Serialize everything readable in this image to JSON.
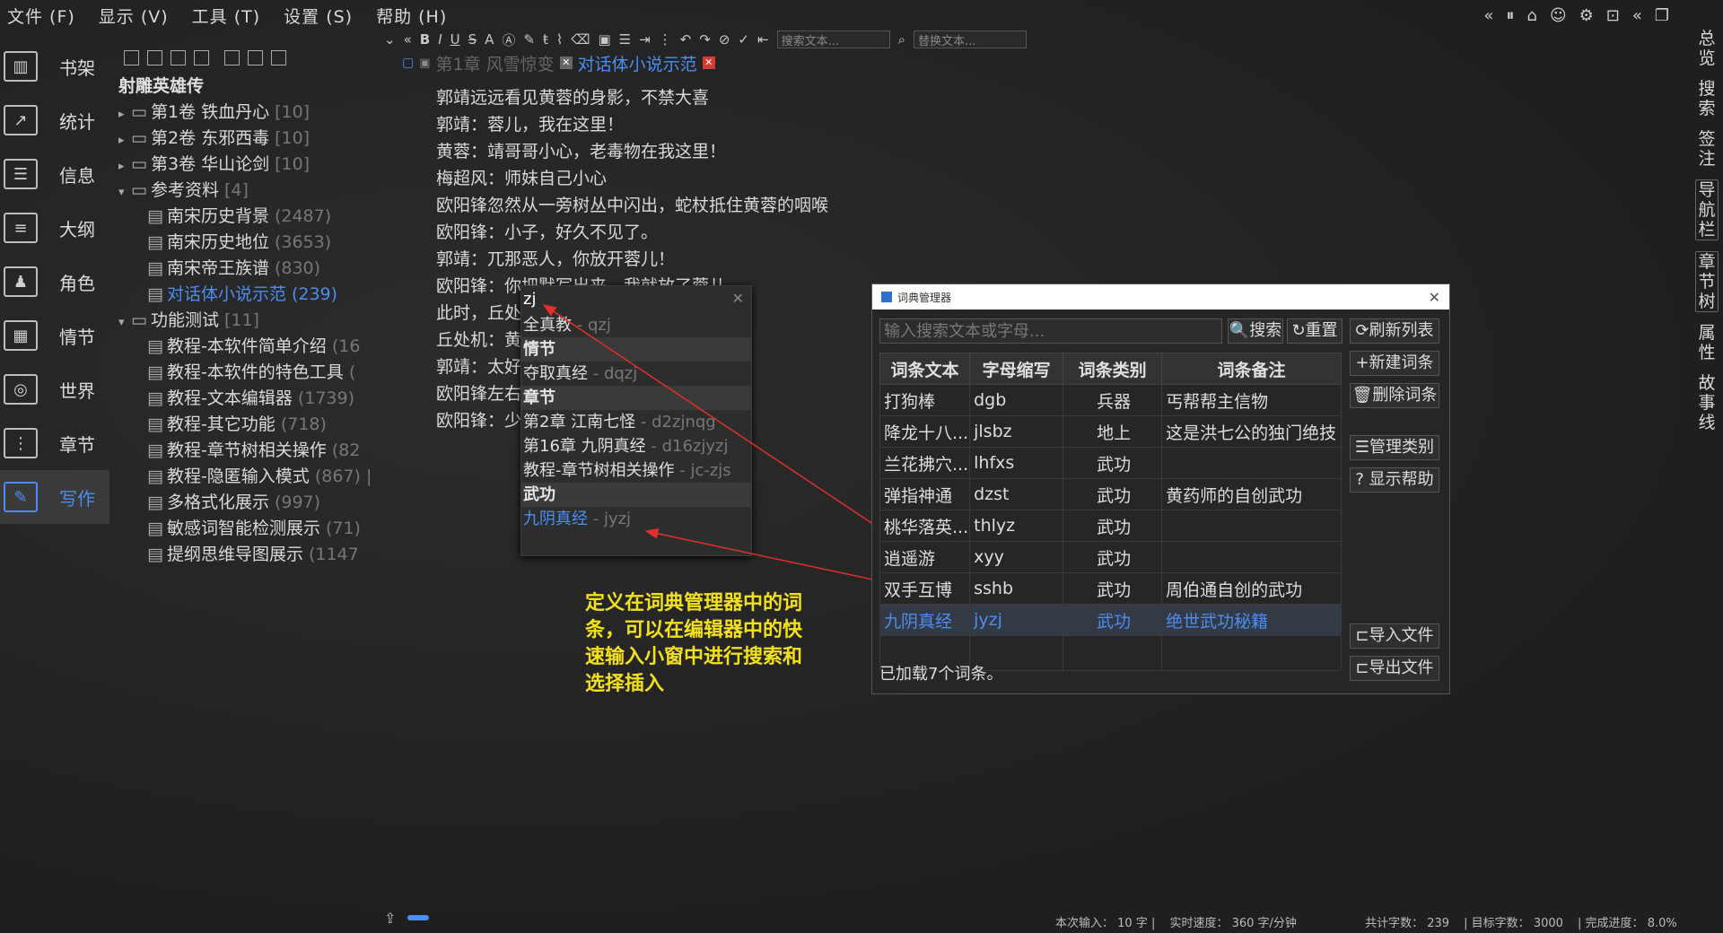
{
  "menu": [
    "文件 (F)",
    "显示 (V)",
    "工具 (T)",
    "设置 (S)",
    "帮助 (H)"
  ],
  "leftnav": [
    {
      "label": "书架",
      "icon": "bookshelf-icon",
      "glyph": "▥"
    },
    {
      "label": "统计",
      "icon": "stats-icon",
      "glyph": "↗"
    },
    {
      "label": "信息",
      "icon": "info-icon",
      "glyph": "☰"
    },
    {
      "label": "大纲",
      "icon": "outline-icon",
      "glyph": "≡"
    },
    {
      "label": "角色",
      "icon": "characters-icon",
      "glyph": "♟"
    },
    {
      "label": "情节",
      "icon": "plot-icon",
      "glyph": "▦"
    },
    {
      "label": "世界",
      "icon": "world-icon",
      "glyph": "◎"
    },
    {
      "label": "章节",
      "icon": "chapters-icon",
      "glyph": "⋮"
    },
    {
      "label": "写作",
      "icon": "write-icon",
      "glyph": "✎"
    }
  ],
  "tree": {
    "book": "射雕英雄传",
    "items": [
      {
        "label": "第1卷 铁血丹心",
        "count": "[10]"
      },
      {
        "label": "第2卷 东邪西毒",
        "count": "[10]"
      },
      {
        "label": "第3卷 华山论剑",
        "count": "[10]"
      },
      {
        "label": "参考资料",
        "count": "[4]"
      },
      {
        "label": "南宋历史背景",
        "count": "(2487)"
      },
      {
        "label": "南宋历史地位",
        "count": "(3653)"
      },
      {
        "label": "南宋帝王族谱",
        "count": "(830)"
      },
      {
        "label": "对话体小说示范",
        "count": "(239)"
      },
      {
        "label": "功能测试",
        "count": "[11]"
      },
      {
        "label": "教程-本软件简单介绍",
        "count": "(16"
      },
      {
        "label": "教程-本软件的特色工具",
        "count": "("
      },
      {
        "label": "教程-文本编辑器",
        "count": "(1739)"
      },
      {
        "label": "教程-其它功能",
        "count": "(718)"
      },
      {
        "label": "教程-章节树相关操作",
        "count": "(82"
      },
      {
        "label": "教程-隐匿输入模式",
        "count": "(867) |"
      },
      {
        "label": "多格式化展示",
        "count": "(997)"
      },
      {
        "label": "敏感词智能检测展示",
        "count": "(71)"
      },
      {
        "label": "提纲思维导图展示",
        "count": "(1147"
      }
    ]
  },
  "search": {
    "find_placeholder": "搜索文本...",
    "replace_placeholder": "替换文本..."
  },
  "tabs": [
    {
      "label": "第1章 风雪惊变"
    },
    {
      "label": "对话体小说示范"
    }
  ],
  "editor": [
    "郭靖远远看见黄蓉的身影，不禁大喜",
    "郭靖：蓉儿，我在这里！",
    "黄蓉：靖哥哥小心，老毒物在我这里！",
    "梅超风：师妹自己小心",
    "欧阳锋忽然从一旁树丛中闪出，蛇杖抵住黄蓉的咽喉",
    "欧阳锋：小子，好久不见了。",
    "郭靖：兀那恶人，你放开蓉儿！",
    "欧阳锋：你把默写出来，我就放了蓉儿",
    "此时，丘处",
    "丘处机：黄                           休要放肆。",
    "郭靖：太好                        还怕老毒物不成?",
    "欧阳锋左右",
    "欧阳锋：少                      他们打个平手。"
  ],
  "quick_popup": {
    "input": "zj",
    "rows": [
      {
        "text": "全真教",
        "abbr": " - qzj",
        "type": "item"
      },
      {
        "text": "情节",
        "abbr": "",
        "type": "header"
      },
      {
        "text": "夺取真经",
        "abbr": " - dqzj",
        "type": "item"
      },
      {
        "text": "章节",
        "abbr": "",
        "type": "header"
      },
      {
        "text": "第2章 江南七怪",
        "abbr": " - d2zjnqg",
        "type": "item"
      },
      {
        "text": "第16章 九阴真经",
        "abbr": " - d16zjyzj",
        "type": "item"
      },
      {
        "text": "教程-章节树相关操作",
        "abbr": " - jc-zjs",
        "type": "item"
      },
      {
        "text": "武功",
        "abbr": "",
        "type": "header"
      },
      {
        "text": "九阴真经",
        "abbr": " - jyzj",
        "type": "selected"
      }
    ]
  },
  "annotation": "定义在词典管理器中的词条，可以在编辑器中的快速输入小窗中进行搜索和选择插入",
  "dialog": {
    "title": "词典管理器",
    "search_placeholder": "输入搜索文本或字母...",
    "buttons": {
      "search": "🔍搜索",
      "reset": "↻重置",
      "refresh": "⟳刷新列表",
      "new": "+新建词条",
      "delete": "🗑删除词条",
      "manage": "☰管理类别",
      "help": "? 显示帮助",
      "import": "⊏导入文件",
      "export": "⊏导出文件"
    },
    "columns": [
      "词条文本",
      "字母缩写",
      "词条类别",
      "词条备注"
    ],
    "rows": [
      [
        "打狗棒",
        "dgb",
        "兵器",
        "丐帮帮主信物"
      ],
      [
        "降龙十八...",
        "jlsbz",
        "地上",
        "这是洪七公的独门绝技"
      ],
      [
        "兰花拂穴...",
        "lhfxs",
        "武功",
        ""
      ],
      [
        "弹指神通",
        "dzst",
        "武功",
        "黄药师的自创武功"
      ],
      [
        "桃华落英...",
        "thlyz",
        "武功",
        ""
      ],
      [
        "逍遥游",
        "xyy",
        "武功",
        ""
      ],
      [
        "双手互博",
        "sshb",
        "武功",
        "周伯通自创的武功"
      ],
      [
        "九阴真经",
        "jyzj",
        "武功",
        "绝世武功秘籍"
      ]
    ],
    "status": "已加载7个词条。"
  },
  "right_tabs": [
    "总览",
    "搜索",
    "签注",
    "导航栏",
    "章节树",
    "属性",
    "故事线"
  ],
  "statusbar": {
    "input": "本次输入： 10  字 |",
    "speed": "实时速度： 360  字/分钟",
    "total": "共计字数： 239",
    "target": "| 目标字数： 3000",
    "progress": "| 完成进度： 8.0%"
  },
  "colors": {
    "accent": "#4b8df0",
    "annotation": "#f2e01a",
    "arrow": "#e0302a"
  }
}
